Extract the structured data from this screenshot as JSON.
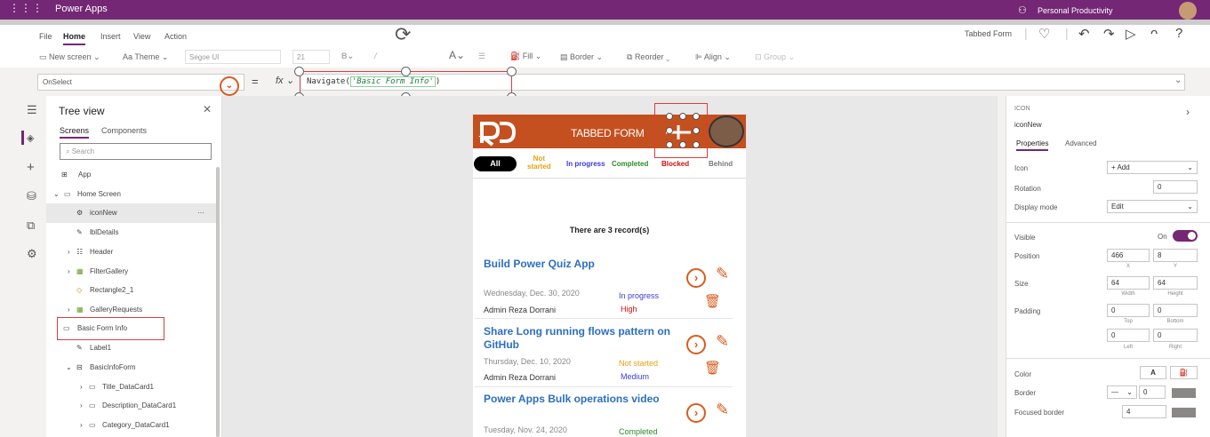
{
  "titlebar": {
    "app_name": "Power Apps",
    "environment": "Personal Productivity"
  },
  "menu": {
    "items": [
      "File",
      "Home",
      "Insert",
      "View",
      "Action"
    ],
    "active": "Home",
    "form_label": "Tabbed Form"
  },
  "toolbar": {
    "new_screen": "New screen",
    "theme": "Theme",
    "font": "Segoe UI",
    "font_size": "21",
    "fill": "Fill",
    "border": "Border",
    "reorder": "Reorder",
    "align": "Align",
    "group": "Group"
  },
  "formula": {
    "property": "OnSelect",
    "eq": "=",
    "fx": "fx",
    "prefix": "Navigate(",
    "string": "'Basic Form Info'",
    "suffix": ")"
  },
  "tree": {
    "title": "Tree view",
    "tabs": [
      "Screens",
      "Components"
    ],
    "search_placeholder": "Search",
    "rows": [
      "App",
      "Home Screen",
      "iconNew",
      "lblDetails",
      "Header",
      "FilterGallery",
      "Rectangle2_1",
      "GalleryRequests",
      "Basic Form Info",
      "Label1",
      "BasicInfoForm",
      "Title_DataCard1",
      "Description_DataCard1",
      "Category_DataCard1"
    ]
  },
  "app": {
    "title": "TABBED FORM",
    "filters": {
      "all": "All",
      "not_started_1": "Not",
      "not_started_2": "started",
      "in_progress": "In progress",
      "completed": "Completed",
      "blocked": "Blocked",
      "behind": "Behind"
    },
    "records_text": "There are 3  record(s)",
    "cards": [
      {
        "title": "Build Power Quiz App",
        "date": "Wednesday, Dec. 30, 2020",
        "user": "Admin Reza Dorrani",
        "status": "In progress",
        "priority": "High"
      },
      {
        "title": "Share Long running flows pattern on GitHub",
        "date": "Thursday, Dec. 10, 2020",
        "user": "Admin Reza Dorrani",
        "status": "Not started",
        "priority": "Medium"
      },
      {
        "title": "Power Apps Bulk operations video",
        "date": "Tuesday, Nov. 24, 2020",
        "status": "Completed"
      }
    ]
  },
  "props": {
    "type": "ICON",
    "name": "iconNew",
    "tabs": [
      "Properties",
      "Advanced"
    ],
    "icon_label": "Icon",
    "icon_value": "+ Add",
    "rotation_label": "Rotation",
    "rotation_value": "0",
    "display_mode_label": "Display mode",
    "display_mode_value": "Edit",
    "visible_label": "Visible",
    "visible_value": "On",
    "position_label": "Position",
    "pos_x": "466",
    "pos_y": "8",
    "x_label": "X",
    "y_label": "Y",
    "size_label": "Size",
    "width": "64",
    "height": "64",
    "width_label": "Width",
    "height_label": "Height",
    "padding_label": "Padding",
    "pad_top": "0",
    "pad_bottom": "0",
    "pad_left": "0",
    "pad_right": "0",
    "top_label": "Top",
    "bottom_label": "Bottom",
    "left_label": "Left",
    "right_label": "Right",
    "color_label": "Color",
    "color_a": "A",
    "border_label": "Border",
    "border_value": "0",
    "focused_border_label": "Focused border",
    "focused_border_value": "4"
  },
  "colors": {
    "brand": "#742774",
    "app_header": "#c4501f",
    "accent": "#d95c1e",
    "highlight": "#d43f3f"
  }
}
